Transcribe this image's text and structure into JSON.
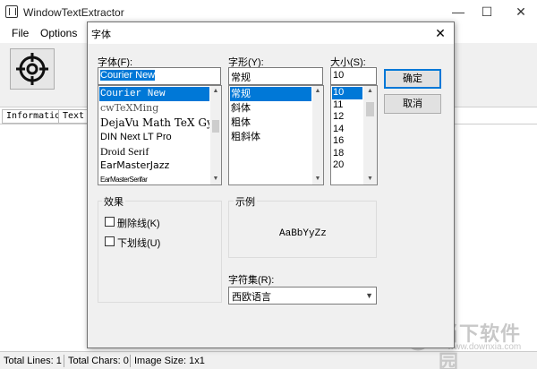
{
  "window": {
    "title": "WindowTextExtractor",
    "controls": {
      "minimize": "—",
      "maximize": "☐",
      "close": "✕"
    }
  },
  "menu": {
    "items": [
      "File",
      "Options"
    ]
  },
  "toolbar": {
    "target_icon": "crosshair-target-icon"
  },
  "tabs": [
    "Information",
    "Text"
  ],
  "status": {
    "total_lines": "Total Lines: 1",
    "total_chars": "Total Chars: 0",
    "image_size": "Image Size: 1x1"
  },
  "watermark": {
    "text": "当下软件园",
    "url": "www.downxia.com"
  },
  "dialog": {
    "title": "字体",
    "close": "✕",
    "font_label": "字体(F):",
    "font_value": "Courier New",
    "font_list": [
      "Courier New",
      "cwTeXMing",
      "DejaVu Math TeX Gyr",
      "DIN Next LT Pro",
      "Droid Serif",
      "EarMasterJazz",
      "EarMasterSerifar"
    ],
    "font_selected_index": 0,
    "style_label": "字形(Y):",
    "style_value": "常规",
    "style_list": [
      "常规",
      "斜体",
      "粗体",
      "粗斜体"
    ],
    "style_selected_index": 0,
    "size_label": "大小(S):",
    "size_value": "10",
    "size_list": [
      "10",
      "11",
      "12",
      "14",
      "16",
      "18",
      "20"
    ],
    "size_selected_index": 0,
    "ok_button": "确定",
    "cancel_button": "取消",
    "effects_label": "效果",
    "strikeout_label": "删除线(K)",
    "underline_label": "下划线(U)",
    "sample_label": "示例",
    "sample_text": "AaBbYyZz",
    "charset_label": "字符集(R):",
    "charset_value": "西欧语言"
  },
  "colors": {
    "selection": "#0078d7",
    "dialog_bg": "#f0f0f0"
  }
}
